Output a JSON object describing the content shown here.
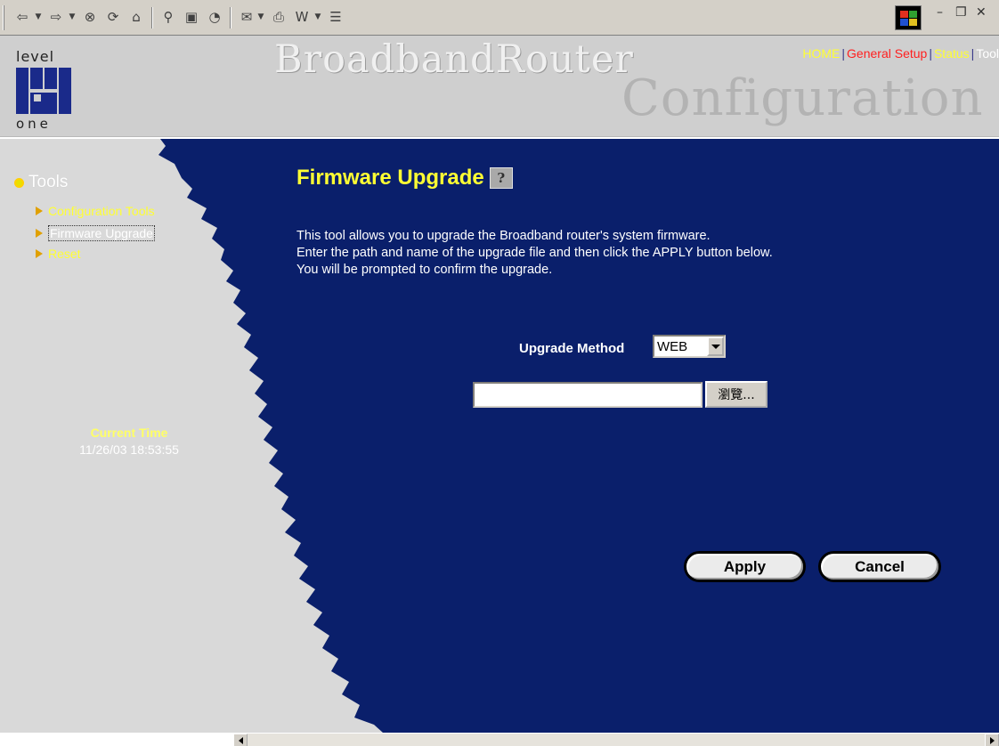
{
  "header": {
    "logo_top": "level",
    "logo_bottom": "one",
    "brand_title": "BroadbandRouter",
    "brand_subtitle": "Configuration",
    "nav": [
      {
        "label": "HOME",
        "color": "#ffff33"
      },
      {
        "label": "General Setup",
        "color": "#ff2020"
      },
      {
        "label": "Status",
        "color": "#ffff33"
      },
      {
        "label": "Tool",
        "color": "#ffffff"
      }
    ],
    "nav_separator": "|"
  },
  "sidebar": {
    "section_title": "Tools",
    "items": [
      {
        "label": "Configuration Tools",
        "color": "#ffff33",
        "active": false
      },
      {
        "label": "Firmware Upgrade",
        "color": "#ffffff",
        "active": true
      },
      {
        "label": "Reset",
        "color": "#ffff33",
        "active": false
      }
    ],
    "current_time_label": "Current Time",
    "current_time_value": "11/26/03 18:53:55"
  },
  "main": {
    "page_title": "Firmware Upgrade",
    "help_icon_glyph": "?",
    "description": [
      "This tool allows you to upgrade the Broadband router's system firmware.",
      "Enter the path and name of the upgrade file and then click the APPLY button below.",
      "You will be prompted to confirm the upgrade."
    ],
    "upgrade_method_label": "Upgrade Method",
    "upgrade_method_value": "WEB",
    "file_path_value": "",
    "browse_label": "瀏覽...",
    "apply_label": "Apply",
    "cancel_label": "Cancel"
  },
  "colors": {
    "main_bg": "#0a1f6b",
    "sidebar_bg": "#d9d9d9",
    "title_yellow": "#ffff33"
  },
  "icons": [
    "back-icon",
    "forward-icon",
    "stop-icon",
    "refresh-icon",
    "home-icon",
    "search-icon",
    "favorites-icon",
    "history-icon",
    "mail-icon",
    "print-icon",
    "edit-icon",
    "discuss-icon",
    "windows-logo-icon",
    "help-icon"
  ]
}
